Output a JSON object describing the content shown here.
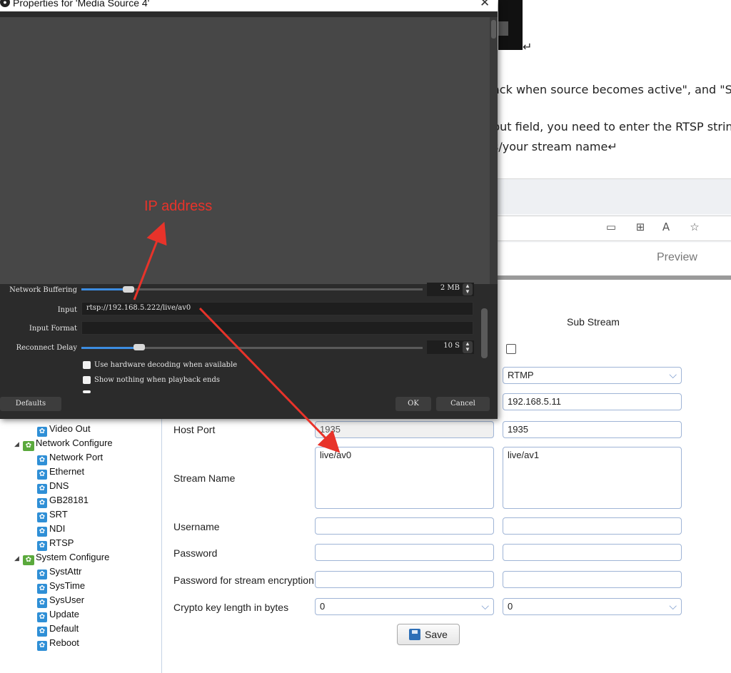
{
  "doc": {
    "line1": "ack when source becomes active\", and \"Sh",
    "line2": "put field, you need to enter the RTSP string",
    "line3": "s/your stream name↵",
    "line4": "↵"
  },
  "browser": {
    "preview_tab": "Preview",
    "icons": [
      "tablet-icon",
      "grid-icon",
      "read-aloud-icon",
      "favorites-icon"
    ]
  },
  "dialog": {
    "title": "Properties for 'Media Source 4'",
    "annotation": "IP address",
    "network_buffering": {
      "label": "Network Buffering",
      "value": "2 MB",
      "fill_fraction": 0.14
    },
    "input": {
      "label": "Input",
      "value": "rtsp://192.168.5.222/live/av0"
    },
    "input_format": {
      "label": "Input Format",
      "value": ""
    },
    "reconnect_delay": {
      "label": "Reconnect Delay",
      "value": "10 S",
      "fill_fraction": 0.17
    },
    "checkboxes": [
      "Use hardware decoding when available",
      "Show nothing when playback ends"
    ],
    "buttons": {
      "defaults": "Defaults",
      "ok": "OK",
      "cancel": "Cancel"
    }
  },
  "tree": {
    "video_out": "Video Out",
    "network_configure": "Network Configure",
    "network_items": [
      "Network Port",
      "Ethernet",
      "DNS",
      "GB28181",
      "SRT",
      "NDI",
      "RTSP"
    ],
    "system_configure": "System Configure",
    "system_items": [
      "SystAttr",
      "SysTime",
      "SysUser",
      "Update",
      "Default",
      "Reboot"
    ]
  },
  "form": {
    "sub_stream_header": "Sub Stream",
    "protocol": {
      "sub": "RTMP"
    },
    "host": {
      "sub": "192.168.5.11"
    },
    "host_port": {
      "label": "Host Port",
      "main": "1935",
      "sub": "1935"
    },
    "stream_name": {
      "label": "Stream Name",
      "main": "live/av0",
      "sub": "live/av1"
    },
    "username": {
      "label": "Username",
      "main": "",
      "sub": ""
    },
    "password": {
      "label": "Password",
      "main": "",
      "sub": ""
    },
    "password_encryption": {
      "label": "Password for stream encryption",
      "main": "",
      "sub": ""
    },
    "crypto_key": {
      "label": "Crypto key length in bytes",
      "main": "0",
      "sub": "0"
    },
    "save": "Save"
  }
}
